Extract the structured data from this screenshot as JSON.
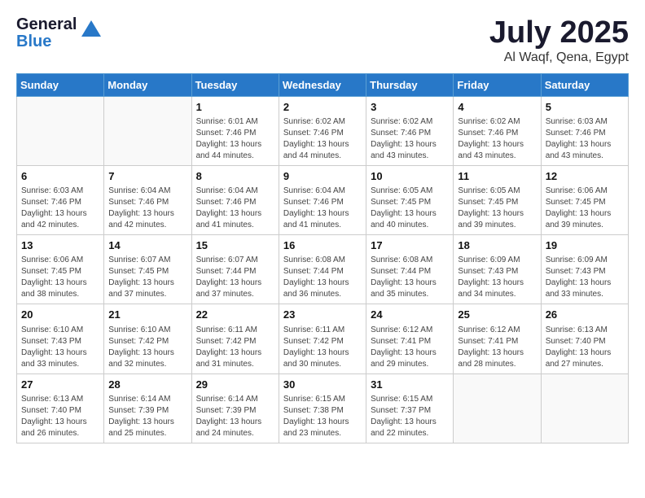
{
  "header": {
    "logo_general": "General",
    "logo_blue": "Blue",
    "month_year": "July 2025",
    "location": "Al Waqf, Qena, Egypt"
  },
  "days_of_week": [
    "Sunday",
    "Monday",
    "Tuesday",
    "Wednesday",
    "Thursday",
    "Friday",
    "Saturday"
  ],
  "weeks": [
    [
      {
        "day": "",
        "info": ""
      },
      {
        "day": "",
        "info": ""
      },
      {
        "day": "1",
        "info": "Sunrise: 6:01 AM\nSunset: 7:46 PM\nDaylight: 13 hours and 44 minutes."
      },
      {
        "day": "2",
        "info": "Sunrise: 6:02 AM\nSunset: 7:46 PM\nDaylight: 13 hours and 44 minutes."
      },
      {
        "day": "3",
        "info": "Sunrise: 6:02 AM\nSunset: 7:46 PM\nDaylight: 13 hours and 43 minutes."
      },
      {
        "day": "4",
        "info": "Sunrise: 6:02 AM\nSunset: 7:46 PM\nDaylight: 13 hours and 43 minutes."
      },
      {
        "day": "5",
        "info": "Sunrise: 6:03 AM\nSunset: 7:46 PM\nDaylight: 13 hours and 43 minutes."
      }
    ],
    [
      {
        "day": "6",
        "info": "Sunrise: 6:03 AM\nSunset: 7:46 PM\nDaylight: 13 hours and 42 minutes."
      },
      {
        "day": "7",
        "info": "Sunrise: 6:04 AM\nSunset: 7:46 PM\nDaylight: 13 hours and 42 minutes."
      },
      {
        "day": "8",
        "info": "Sunrise: 6:04 AM\nSunset: 7:46 PM\nDaylight: 13 hours and 41 minutes."
      },
      {
        "day": "9",
        "info": "Sunrise: 6:04 AM\nSunset: 7:46 PM\nDaylight: 13 hours and 41 minutes."
      },
      {
        "day": "10",
        "info": "Sunrise: 6:05 AM\nSunset: 7:45 PM\nDaylight: 13 hours and 40 minutes."
      },
      {
        "day": "11",
        "info": "Sunrise: 6:05 AM\nSunset: 7:45 PM\nDaylight: 13 hours and 39 minutes."
      },
      {
        "day": "12",
        "info": "Sunrise: 6:06 AM\nSunset: 7:45 PM\nDaylight: 13 hours and 39 minutes."
      }
    ],
    [
      {
        "day": "13",
        "info": "Sunrise: 6:06 AM\nSunset: 7:45 PM\nDaylight: 13 hours and 38 minutes."
      },
      {
        "day": "14",
        "info": "Sunrise: 6:07 AM\nSunset: 7:45 PM\nDaylight: 13 hours and 37 minutes."
      },
      {
        "day": "15",
        "info": "Sunrise: 6:07 AM\nSunset: 7:44 PM\nDaylight: 13 hours and 37 minutes."
      },
      {
        "day": "16",
        "info": "Sunrise: 6:08 AM\nSunset: 7:44 PM\nDaylight: 13 hours and 36 minutes."
      },
      {
        "day": "17",
        "info": "Sunrise: 6:08 AM\nSunset: 7:44 PM\nDaylight: 13 hours and 35 minutes."
      },
      {
        "day": "18",
        "info": "Sunrise: 6:09 AM\nSunset: 7:43 PM\nDaylight: 13 hours and 34 minutes."
      },
      {
        "day": "19",
        "info": "Sunrise: 6:09 AM\nSunset: 7:43 PM\nDaylight: 13 hours and 33 minutes."
      }
    ],
    [
      {
        "day": "20",
        "info": "Sunrise: 6:10 AM\nSunset: 7:43 PM\nDaylight: 13 hours and 33 minutes."
      },
      {
        "day": "21",
        "info": "Sunrise: 6:10 AM\nSunset: 7:42 PM\nDaylight: 13 hours and 32 minutes."
      },
      {
        "day": "22",
        "info": "Sunrise: 6:11 AM\nSunset: 7:42 PM\nDaylight: 13 hours and 31 minutes."
      },
      {
        "day": "23",
        "info": "Sunrise: 6:11 AM\nSunset: 7:42 PM\nDaylight: 13 hours and 30 minutes."
      },
      {
        "day": "24",
        "info": "Sunrise: 6:12 AM\nSunset: 7:41 PM\nDaylight: 13 hours and 29 minutes."
      },
      {
        "day": "25",
        "info": "Sunrise: 6:12 AM\nSunset: 7:41 PM\nDaylight: 13 hours and 28 minutes."
      },
      {
        "day": "26",
        "info": "Sunrise: 6:13 AM\nSunset: 7:40 PM\nDaylight: 13 hours and 27 minutes."
      }
    ],
    [
      {
        "day": "27",
        "info": "Sunrise: 6:13 AM\nSunset: 7:40 PM\nDaylight: 13 hours and 26 minutes."
      },
      {
        "day": "28",
        "info": "Sunrise: 6:14 AM\nSunset: 7:39 PM\nDaylight: 13 hours and 25 minutes."
      },
      {
        "day": "29",
        "info": "Sunrise: 6:14 AM\nSunset: 7:39 PM\nDaylight: 13 hours and 24 minutes."
      },
      {
        "day": "30",
        "info": "Sunrise: 6:15 AM\nSunset: 7:38 PM\nDaylight: 13 hours and 23 minutes."
      },
      {
        "day": "31",
        "info": "Sunrise: 6:15 AM\nSunset: 7:37 PM\nDaylight: 13 hours and 22 minutes."
      },
      {
        "day": "",
        "info": ""
      },
      {
        "day": "",
        "info": ""
      }
    ]
  ]
}
